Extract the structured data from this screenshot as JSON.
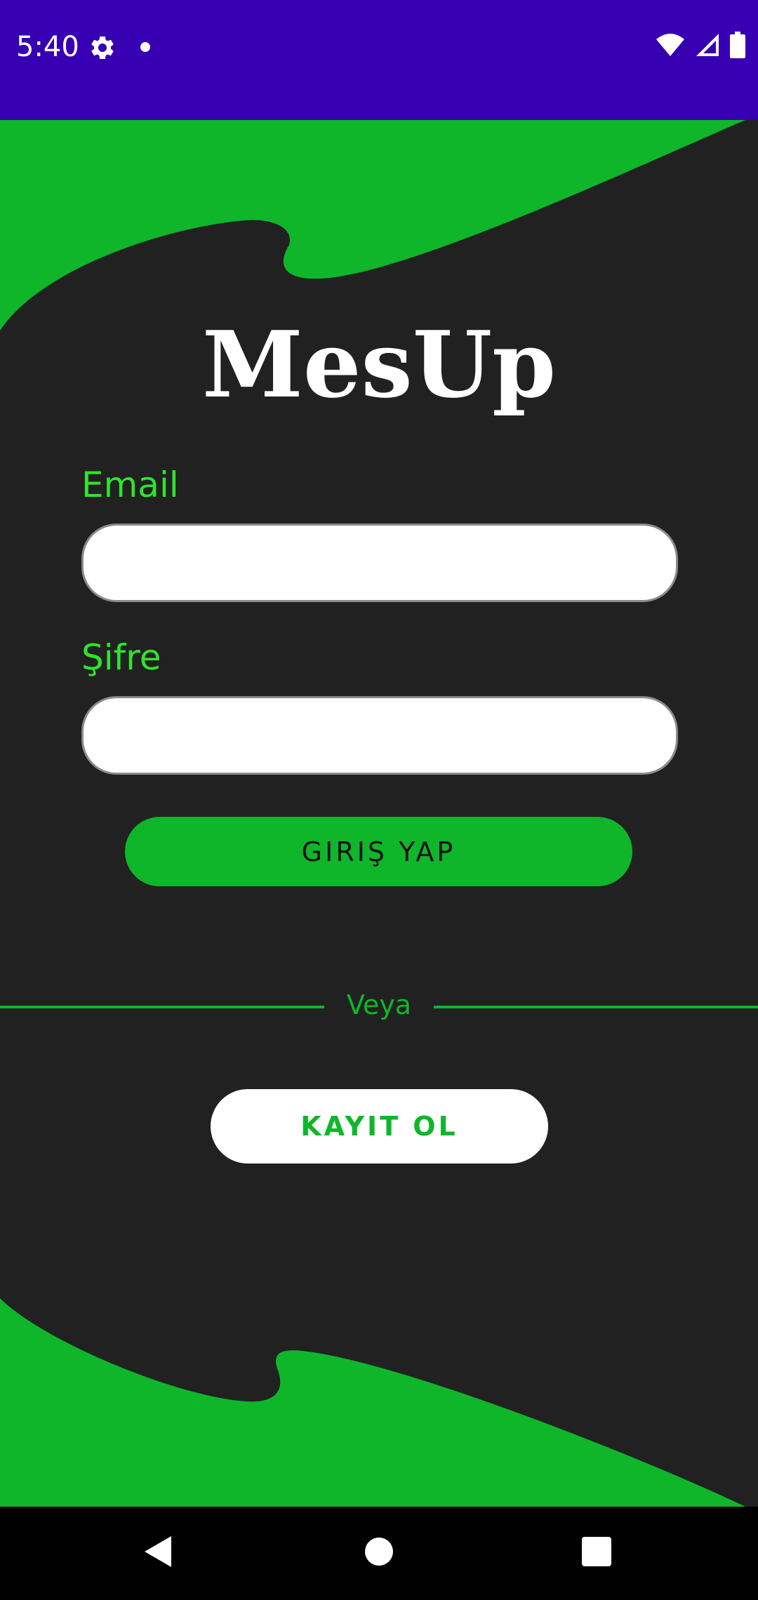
{
  "status_bar": {
    "time": "5:40",
    "background": "#3700B3",
    "icons": [
      "gear-icon",
      "notification-dot-icon",
      "wifi-icon",
      "signal-icon",
      "battery-icon"
    ]
  },
  "app": {
    "title": "MesUp",
    "accent_color": "#0FB62A",
    "label_color": "#2EE52B",
    "background": "#212121"
  },
  "form": {
    "email_label": "Email",
    "email_value": "",
    "password_label": "Şifre",
    "password_value": "",
    "login_button": "GIRIŞ YAP",
    "divider_text": "Veya",
    "register_button": "KAYIT OL"
  },
  "nav_bar": {
    "icons": [
      "back-icon",
      "home-icon",
      "recents-icon"
    ]
  }
}
